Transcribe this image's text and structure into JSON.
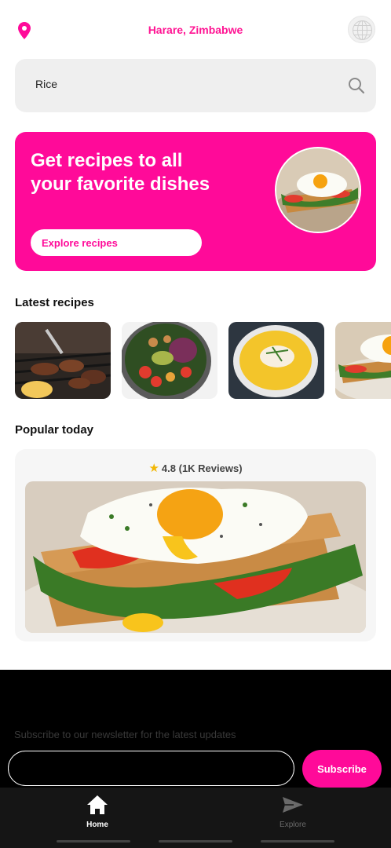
{
  "header": {
    "location": "Harare, Zimbabwe"
  },
  "search": {
    "value": "Rice"
  },
  "hero": {
    "title": "Get recipes to all your favorite dishes",
    "button_label": "Explore recipes"
  },
  "latest": {
    "title": "Latest recipes",
    "items": [
      "grilled-meat",
      "salad-bowl",
      "curry-soup",
      "egg-toast"
    ]
  },
  "popular": {
    "title": "Popular today",
    "rating": "4.8",
    "reviews": "(1K Reviews)"
  },
  "footer": {
    "newsletter_text": "Subscribe to our newsletter for the latest updates",
    "subscribe_label": "Subscribe"
  },
  "nav": {
    "home": "Home",
    "explore": "Explore"
  },
  "colors": {
    "accent": "#ff0a99",
    "background": "#ffffff",
    "footer": "#000000",
    "nav": "#151515"
  },
  "icons": [
    "location-pin-icon",
    "globe-icon",
    "search-icon",
    "star-icon",
    "home-icon",
    "send-icon"
  ]
}
